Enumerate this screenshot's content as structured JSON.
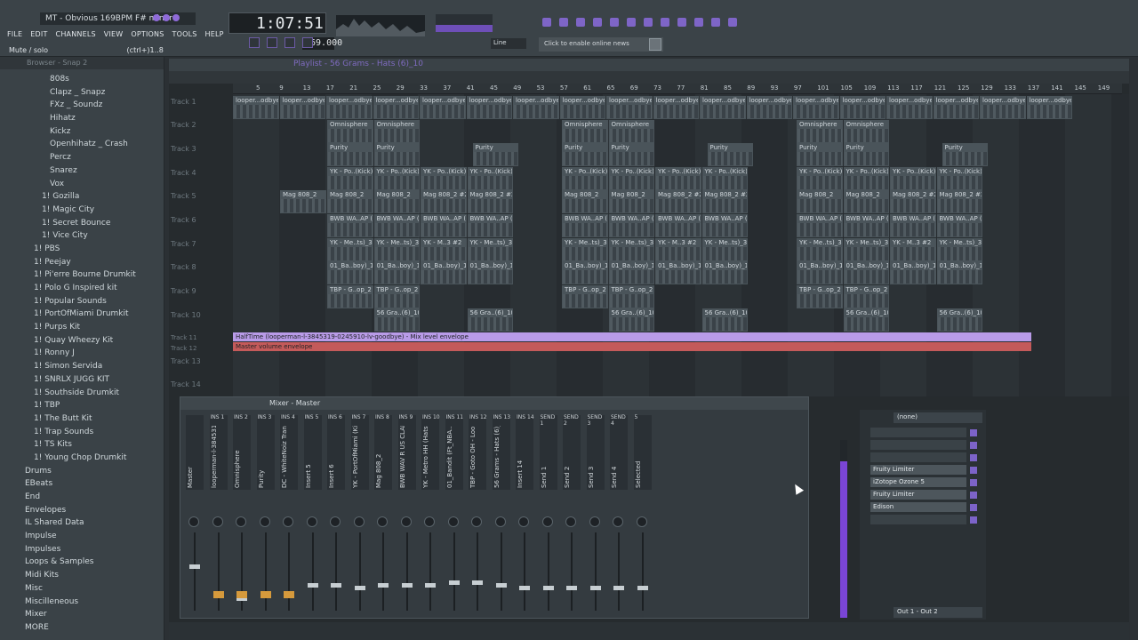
{
  "window": {
    "title": "MT - Obvious 169BPM F# minor"
  },
  "menu": [
    "FILE",
    "EDIT",
    "CHANNELS",
    "VIEW",
    "OPTIONS",
    "TOOLS",
    "HELP"
  ],
  "hint": {
    "left": "Mute / solo",
    "right": "(ctrl+)1..8"
  },
  "transport": {
    "time": "1:07:51",
    "tempo": "169.000",
    "mode": "Line"
  },
  "news": "Click to enable online news",
  "browser": {
    "title": "Browser - Snap 2",
    "items": [
      {
        "label": "808s",
        "level": 3
      },
      {
        "label": "Clapz _ Snapz",
        "level": 3
      },
      {
        "label": "FXz _ Soundz",
        "level": 3
      },
      {
        "label": "Hihatz",
        "level": 3
      },
      {
        "label": "Kickz",
        "level": 3
      },
      {
        "label": "Openhihatz _ Crash",
        "level": 3
      },
      {
        "label": "Percz",
        "level": 3
      },
      {
        "label": "Snarez",
        "level": 3
      },
      {
        "label": "Vox",
        "level": 3
      },
      {
        "label": "1! Gozilla",
        "level": 2
      },
      {
        "label": "1! Magic City",
        "level": 2
      },
      {
        "label": "1! Secret Bounce",
        "level": 2
      },
      {
        "label": "1! Vice City",
        "level": 2
      },
      {
        "label": "1! PBS",
        "level": 1
      },
      {
        "label": "1! Peejay",
        "level": 1
      },
      {
        "label": "1! Pi'erre Bourne Drumkit",
        "level": 1
      },
      {
        "label": "1! Polo G Inspired kit",
        "level": 1
      },
      {
        "label": "1! Popular Sounds",
        "level": 1
      },
      {
        "label": "1! PortOfMiami Drumkit",
        "level": 1
      },
      {
        "label": "1! Purps Kit",
        "level": 1
      },
      {
        "label": "1! Quay Wheezy Kit",
        "level": 1
      },
      {
        "label": "1! Ronny J",
        "level": 1
      },
      {
        "label": "1! Simon Servida",
        "level": 1
      },
      {
        "label": "1! SNRLX JUGG KIT",
        "level": 1
      },
      {
        "label": "1! Southside Drumkit",
        "level": 1
      },
      {
        "label": "1! TBP",
        "level": 1
      },
      {
        "label": "1! The Butt Kit",
        "level": 1
      },
      {
        "label": "1! Trap Sounds",
        "level": 1
      },
      {
        "label": "1! TS Kits",
        "level": 1
      },
      {
        "label": "1! Young Chop Drumkit",
        "level": 1
      },
      {
        "label": "Drums",
        "level": 0
      },
      {
        "label": "EBeats",
        "level": 0
      },
      {
        "label": "End",
        "level": 0
      },
      {
        "label": "Envelopes",
        "level": 0
      },
      {
        "label": "IL Shared Data",
        "level": 0
      },
      {
        "label": "Impulse",
        "level": 0
      },
      {
        "label": "Impulses",
        "level": 0
      },
      {
        "label": "Loops & Samples",
        "level": 0
      },
      {
        "label": "Midi Kits",
        "level": 0
      },
      {
        "label": "Misc",
        "level": 0
      },
      {
        "label": "Miscilleneous",
        "level": 0
      },
      {
        "label": "Mixer",
        "level": 0
      },
      {
        "label": "MORE",
        "level": 0
      }
    ]
  },
  "playlist": {
    "title": "Playlist - 56 Grams - Hats (6)_10",
    "ruler": [
      "5",
      "9",
      "13",
      "17",
      "21",
      "25",
      "29",
      "33",
      "37",
      "41",
      "45",
      "49",
      "53",
      "57",
      "61",
      "65",
      "69",
      "73",
      "77",
      "81",
      "85",
      "89",
      "93",
      "97",
      "101",
      "105",
      "109",
      "113",
      "117",
      "121",
      "125",
      "129",
      "133",
      "137",
      "141",
      "145",
      "149"
    ],
    "tracks": [
      "Track 1",
      "Track 2",
      "Track 3",
      "Track 4",
      "Track 5",
      "Track 6",
      "Track 7",
      "Track 8",
      "Track 9",
      "Track 10",
      "Track 11",
      "Track 12",
      "Track 13",
      "Track 14"
    ],
    "clip_names": {
      "t1": "looper...odbye",
      "t2": "Omnisphere",
      "t3": "Purity",
      "t4": "YK - Po..(Kick)",
      "t5a": "Mag 808_2",
      "t5b": "Mag 808_2 #2",
      "t6": "BWB WA..AP (7)",
      "t7a": "YK - Me..ts)_3",
      "t7b": "YK - M..3 #2",
      "t8": "01_Ba..boy)_1",
      "t9": "TBP - G..op_2",
      "t10": "56 Gra..(6)_10",
      "t11": "HalfTime (looper...evel envelope",
      "t11b": "HalfTime (looperman-l-3845319-0245910-lv-goodbye) - Mix level envelope",
      "t12": "Master volume envelope"
    }
  },
  "mixer": {
    "title": "Mixer - Master",
    "strips": [
      {
        "name": "Master",
        "ins": ""
      },
      {
        "name": "looperman-l-3845319",
        "ins": "INS 1"
      },
      {
        "name": "Omnisphere",
        "ins": "INS 2"
      },
      {
        "name": "Purity",
        "ins": "INS 3"
      },
      {
        "name": "DC - WhiteNoiz Transit",
        "ins": "INS 4"
      },
      {
        "name": "Insert 5",
        "ins": "INS 5"
      },
      {
        "name": "Insert 6",
        "ins": "INS 6"
      },
      {
        "name": "YK - PortOfMiami (Kick)",
        "ins": "INS 7"
      },
      {
        "name": "Mag 808_2",
        "ins": "INS 8"
      },
      {
        "name": "BWB WAV R US CLAP",
        "ins": "INS 9"
      },
      {
        "name": "YK - Metro HH (Hats)",
        "ins": "INS 10"
      },
      {
        "name": "01_Bandit (Ft_NBA...)",
        "ins": "INS 11"
      },
      {
        "name": "TBP - Goto OH - Loop",
        "ins": "INS 12"
      },
      {
        "name": "56 Grams - Hats (6)_1",
        "ins": "INS 13"
      },
      {
        "name": "Insert 14",
        "ins": "INS 14"
      },
      {
        "name": "Send 1",
        "ins": "SEND 1"
      },
      {
        "name": "Send 2",
        "ins": "SEND 2"
      },
      {
        "name": "Send 3",
        "ins": "SEND 3"
      },
      {
        "name": "Send 4",
        "ins": "SEND 4"
      },
      {
        "name": "Selected",
        "ins": "5"
      }
    ],
    "slots": {
      "input": "(none)",
      "fx": [
        "",
        "",
        "",
        "Fruity Limiter",
        "iZotope Ozone 5",
        "Fruity Limiter",
        "Edison",
        ""
      ],
      "output": "Out 1 - Out 2"
    }
  },
  "colors": {
    "accent": "#8f6bd9",
    "orange": "#d69a3c",
    "env_purple": "#b99be8",
    "env_red": "#c45a5a"
  }
}
